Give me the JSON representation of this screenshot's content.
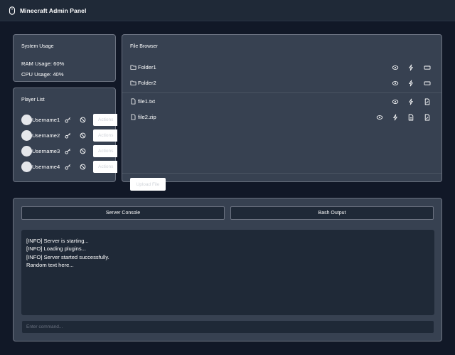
{
  "app": {
    "title": "Minecraft Admin Panel",
    "logo_icon": "mouse-icon"
  },
  "system_usage": {
    "title": "System Usage",
    "ram": "RAM Usage: 60%",
    "cpu": "CPU Usage: 40%"
  },
  "player_list": {
    "title": "Player List",
    "actions_label": "Actions",
    "players": [
      {
        "name": "Username1"
      },
      {
        "name": "Username2"
      },
      {
        "name": "Username3"
      },
      {
        "name": "Username4"
      }
    ]
  },
  "file_browser": {
    "title": "File Browser",
    "upload_label": "Upload File",
    "items": [
      {
        "name": "Folder1",
        "type": "folder",
        "actions": [
          "view-icon",
          "zap-icon",
          "rename-icon"
        ]
      },
      {
        "name": "Folder2",
        "type": "folder",
        "actions": [
          "view-icon",
          "zap-icon",
          "rename-icon"
        ]
      },
      {
        "name": "file1.txt",
        "type": "file",
        "actions": [
          "view-icon",
          "zap-icon",
          "edit-file-icon"
        ]
      },
      {
        "name": "file2.zip",
        "type": "file",
        "actions": [
          "view-icon",
          "zap-icon",
          "file-icon",
          "edit-file-icon"
        ]
      }
    ]
  },
  "console": {
    "tab_server": "Server Console",
    "tab_bash": "Bash Output",
    "lines": [
      "[INFO] Server is starting...",
      "[INFO] Loading plugins...",
      "[INFO] Server started successfully.",
      "Random text here..."
    ],
    "input_placeholder": "Enter command..."
  },
  "colors": {
    "background": "#111827",
    "header": "#1f2937",
    "panel": "#374151",
    "panel_border": "#6b7280",
    "text": "#ffffff"
  }
}
